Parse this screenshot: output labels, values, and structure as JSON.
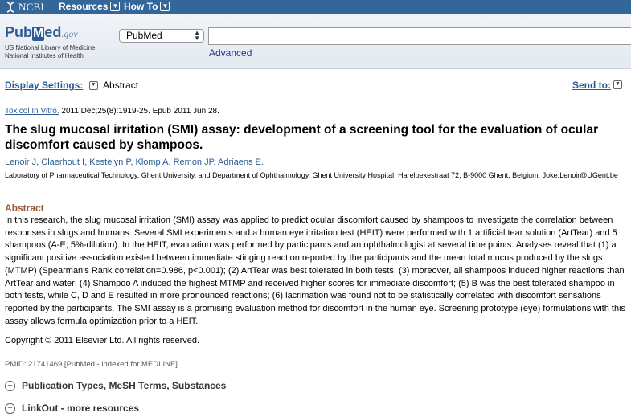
{
  "topbar": {
    "logo_text": "NCBI",
    "resources_label": "Resources",
    "howto_label": "How To"
  },
  "header": {
    "logo_pub": "Pub",
    "logo_m": "M",
    "logo_ed": "ed",
    "logo_gov": ".gov",
    "nlm_line1": "US National Library of Medicine",
    "nlm_line2": "National Institutes of Health",
    "db_selected": "PubMed",
    "search_value": "",
    "advanced_label": "Advanced"
  },
  "display": {
    "settings_label": "Display Settings:",
    "format_value": "Abstract",
    "send_to_label": "Send to:"
  },
  "article": {
    "journal": "Toxicol In Vitro.",
    "citation_rest": " 2011 Dec;25(8):1919-25. Epub 2011 Jun 28.",
    "title": "The slug mucosal irritation (SMI) assay: development of a screening tool for the evaluation of ocular discomfort caused by shampoos.",
    "authors": [
      "Lenoir J",
      "Claerhout I",
      "Kestelyn P",
      "Klomp A",
      "Remon JP",
      "Adriaens E"
    ],
    "affiliation": "Laboratory of Pharmaceutical Technology, Ghent University, and Department of Ophthalmology, Ghent University Hospital, Harelbekestraat 72, B-9000 Ghent, Belgium. Joke.Lenoir@UGent.be",
    "abstract_heading": "Abstract",
    "abstract": "In this research, the slug mucosal irritation (SMI) assay was applied to predict ocular discomfort caused by shampoos to investigate the correlation between responses in slugs and humans. Several SMI experiments and a human eye irritation test (HEIT) were performed with 1 artificial tear solution (ArtTear) and 5 shampoos (A-E; 5%-dilution). In the HEIT, evaluation was performed by participants and an ophthalmologist at several time points. Analyses reveal that (1) a significant positive association existed between immediate stinging reaction reported by the participants and the mean total mucus produced by the slugs (MTMP) (Spearman's Rank correlation=0.986, p<0.001); (2) ArtTear was best tolerated in both tests; (3) moreover, all shampoos induced higher reactions than ArtTear and water; (4) Shampoo A induced the highest MTMP and received higher scores for immediate discomfort; (5) B was the best tolerated shampoo in both tests, while C, D and E resulted in more pronounced reactions; (6) lacrimation was found not to be statistically correlated with discomfort sensations reported by the participants. The SMI assay is a promising evaluation method for discomfort in the human eye. Screening prototype (eye) formulations with this assay allows formula optimization prior to a HEIT.",
    "copyright": "Copyright © 2011 Elsevier Ltd. All rights reserved.",
    "pmid": "PMID: 21741469 [PubMed - indexed for MEDLINE]"
  },
  "expanders": [
    {
      "label": "Publication Types, MeSH Terms, Substances"
    },
    {
      "label": "LinkOut - more resources"
    }
  ]
}
